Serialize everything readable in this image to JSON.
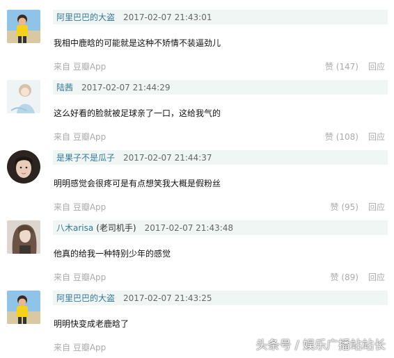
{
  "comments": [
    {
      "username": "阿里巴巴的大盗",
      "note": "",
      "time": "2017-02-07 21:43:01",
      "text": "我相中鹿晗的可能就是这种不矫情不装逼劲儿",
      "source": "来自 豆瓣App",
      "likes": "赞 (147)",
      "reply": "回应",
      "avatar_icon": "boy-beach-avatar"
    },
    {
      "username": "陆茜",
      "note": "",
      "time": "2017-02-07 21:44:29",
      "text": "这么好看的脸就被足球亲了一口，这给我气的",
      "source": "来自 豆瓣App",
      "likes": "赞 (108)",
      "reply": "回应",
      "avatar_icon": "anime-girl-avatar"
    },
    {
      "username": "是果子不是瓜子",
      "note": "",
      "time": "2017-02-07 21:44:37",
      "text": "明明感觉会很疼可是有点想笑我大概是假粉丝",
      "source": "来自 豆瓣App",
      "likes": "赞 (95)",
      "reply": "回应",
      "avatar_icon": "girl-portrait-avatar"
    },
    {
      "username": "八木arisa",
      "note": "(老司机手)",
      "time": "2017-02-07 21:43:48",
      "text": "他真的给我一种特别少年的感觉",
      "source": "来自 豆瓣App",
      "likes": "赞 (89)",
      "reply": "回应",
      "avatar_icon": "woman-hair-avatar"
    },
    {
      "username": "阿里巴巴的大盗",
      "note": "",
      "time": "2017-02-07 21:43:25",
      "text": "明明快变成老鹿晗了",
      "source": "来自 豆瓣App",
      "likes": "",
      "reply": "",
      "avatar_icon": "boy-beach-avatar"
    }
  ],
  "watermark": "头条号 / 娱乐广播站站长",
  "colors": {
    "meta_bar_bg": "#f0f6f3",
    "username": "#337799",
    "muted": "#aaaaaa"
  }
}
